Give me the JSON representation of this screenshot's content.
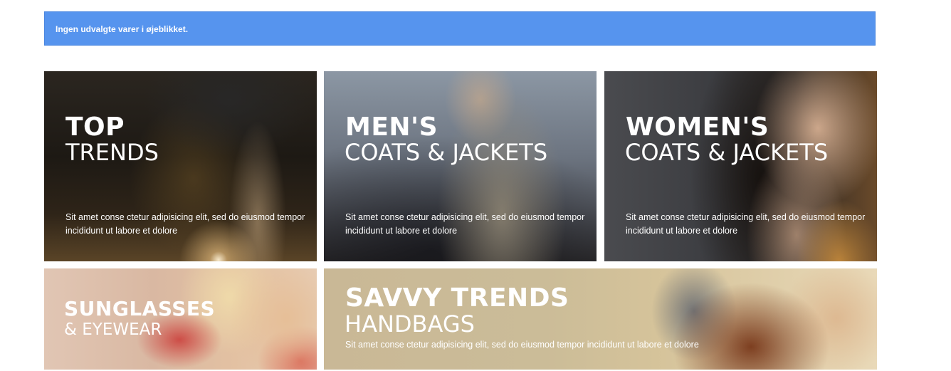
{
  "notice": {
    "text": "Ingen udvalgte varer i øjeblikket."
  },
  "tiles": [
    {
      "title": "TOP",
      "subtitle": "TRENDS",
      "description": "Sit amet conse ctetur adipisicing elit, sed do eiusmod tempor incididunt ut labore et dolore"
    },
    {
      "title": "MEN'S",
      "subtitle": "COATS & JACKETS",
      "description": "Sit amet conse ctetur adipisicing elit, sed do eiusmod tempor incididunt ut labore et dolore"
    },
    {
      "title": "WOMEN'S",
      "subtitle": "COATS & JACKETS",
      "description": "Sit amet conse ctetur adipisicing elit, sed do eiusmod tempor incididunt ut labore et dolore"
    },
    {
      "title": "SUNGLASSES",
      "subtitle": "& EYEWEAR",
      "description": ""
    },
    {
      "title": "SAVVY TRENDS",
      "subtitle": "HANDBAGS",
      "description": "Sit amet conse ctetur adipisicing elit, sed do eiusmod tempor incididunt ut labore et dolore"
    }
  ],
  "colors": {
    "notice_background": "#5694ee",
    "text": "#ffffff"
  }
}
